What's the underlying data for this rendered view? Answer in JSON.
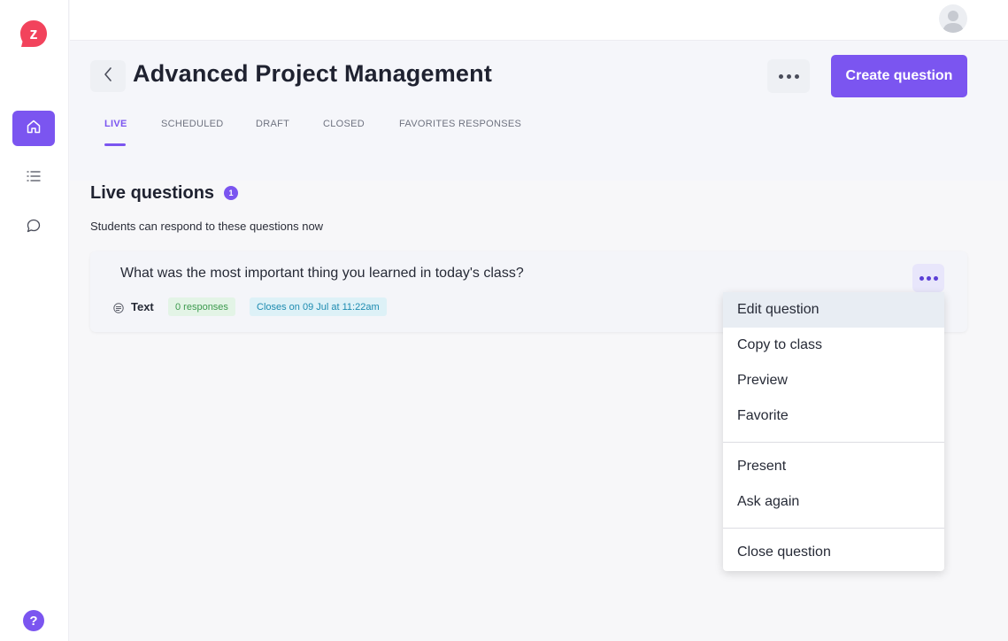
{
  "app": {
    "logo_letter": "z"
  },
  "sidebar": {
    "items": [
      {
        "name": "home",
        "icon": "home-icon",
        "active": true
      },
      {
        "name": "list",
        "icon": "list-icon",
        "active": false
      },
      {
        "name": "chat",
        "icon": "chat-bubble-icon",
        "active": false
      }
    ],
    "help_label": "?"
  },
  "header": {
    "title": "Advanced Project Management",
    "create_button": "Create question",
    "tabs": [
      {
        "label": "LIVE",
        "active": true
      },
      {
        "label": "SCHEDULED",
        "active": false
      },
      {
        "label": "DRAFT",
        "active": false
      },
      {
        "label": "CLOSED",
        "active": false
      },
      {
        "label": "FAVORITES RESPONSES",
        "active": false
      }
    ]
  },
  "section": {
    "title": "Live questions",
    "count": "1",
    "subtitle": "Students can respond to these questions now"
  },
  "question": {
    "text": "What was the most important thing you learned in today's class?",
    "type": "Text",
    "responses": "0 responses",
    "closes": "Closes on 09 Jul at 11:22am"
  },
  "menu": {
    "items": [
      "Edit question",
      "Copy to class",
      "Preview",
      "Favorite",
      "Present",
      "Ask again",
      "Close question"
    ]
  },
  "colors": {
    "accent": "#7b55f0",
    "logo": "#f2435c",
    "background": "#f7f7f9"
  }
}
